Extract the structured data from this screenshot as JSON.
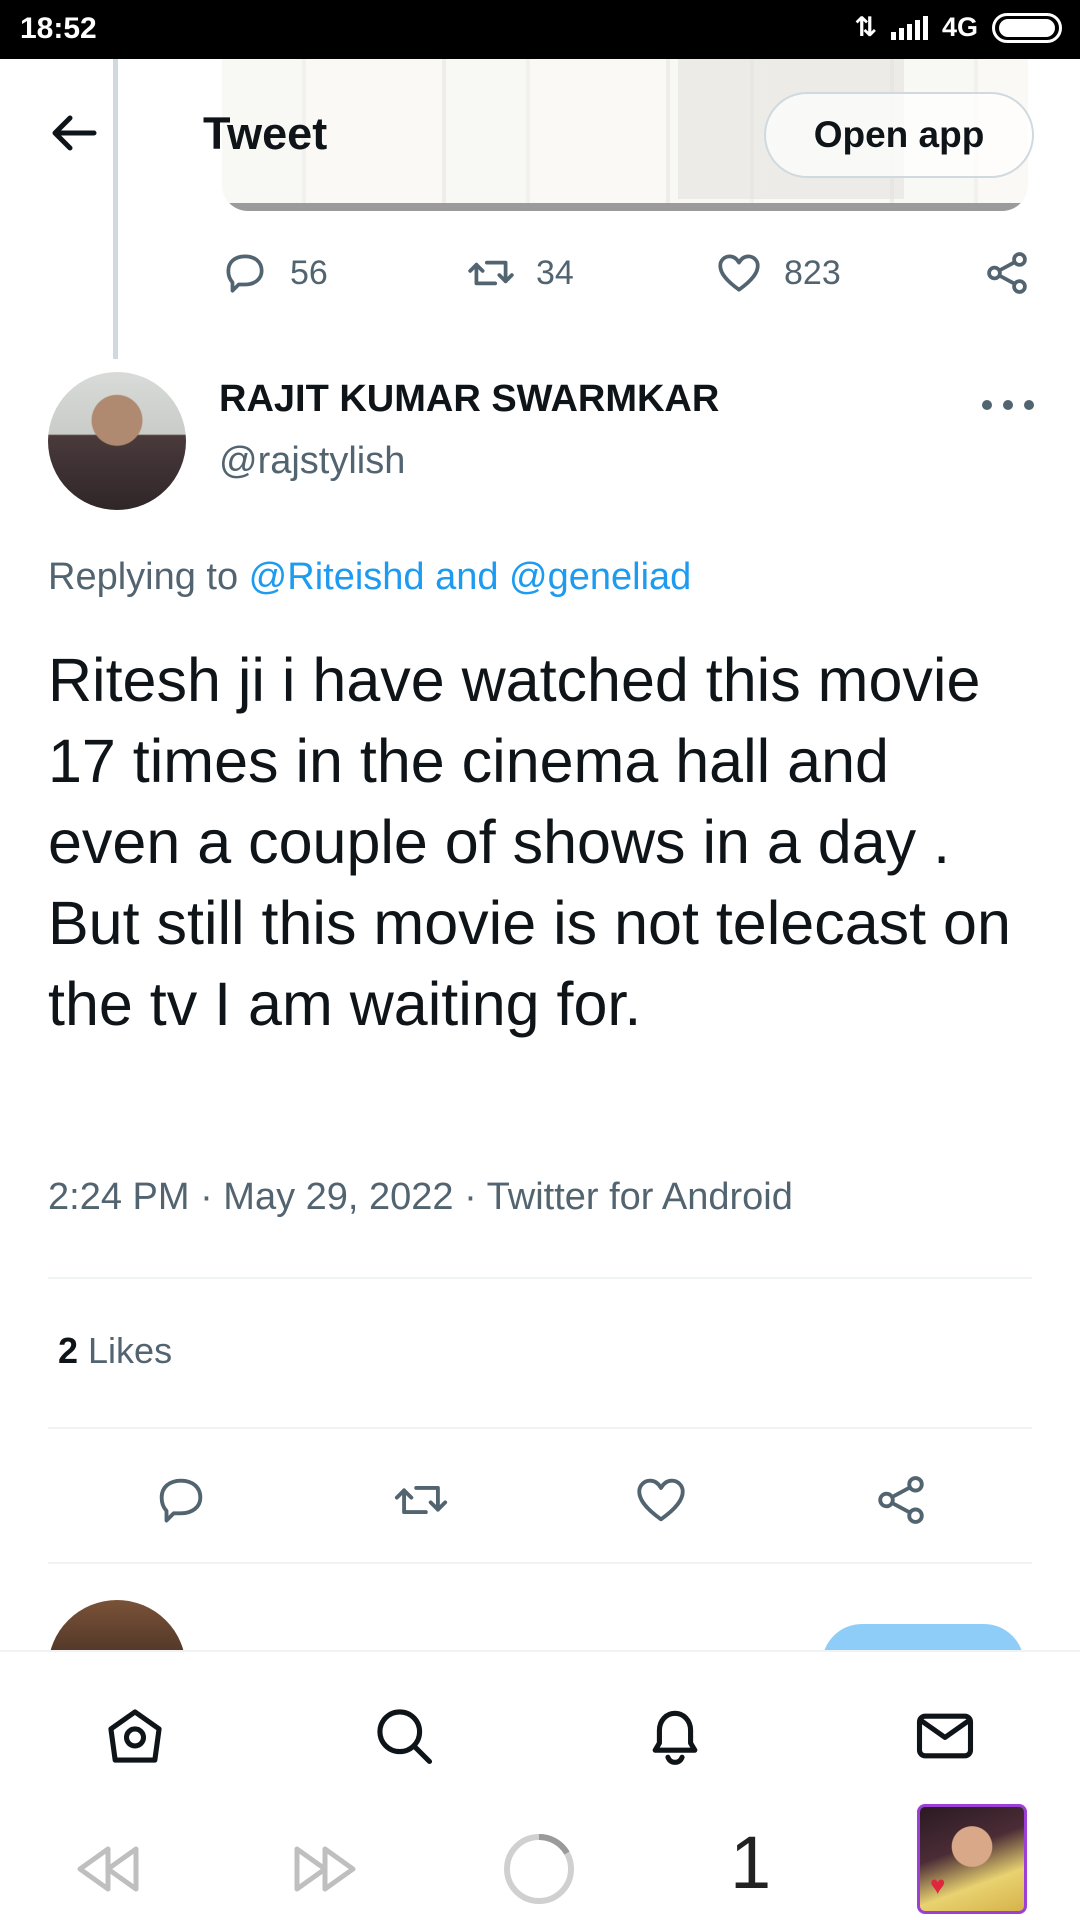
{
  "status_bar": {
    "time": "18:52",
    "network": "4G"
  },
  "header": {
    "title": "Tweet",
    "open_app_label": "Open app",
    "back_icon": "arrow-left-icon"
  },
  "previous_tweet_stats": {
    "replies": "56",
    "retweets": "34",
    "likes": "823"
  },
  "tweet": {
    "author_name": "RAJIT KUMAR SWARMKAR",
    "author_handle": "@rajstylish",
    "replying_prefix": "Replying to ",
    "replying_to": "@Riteishd and @geneliad",
    "text": "Ritesh ji i have watched this movie 17 times in the cinema hall and even a couple of shows in a day . But still this movie is not telecast on the tv I am waiting for.",
    "timestamp": "2:24 PM · May 29, 2022 · Twitter for Android",
    "likes_count": "2",
    "likes_label": " Likes"
  },
  "bottom_nav": {
    "items": [
      "home-icon",
      "search-icon",
      "bell-icon",
      "mail-icon"
    ]
  },
  "system_bar": {
    "page_number": "1"
  },
  "colors": {
    "accent": "#1d9bf0",
    "secondary_text": "#536471",
    "primary_text": "#0f1419"
  }
}
